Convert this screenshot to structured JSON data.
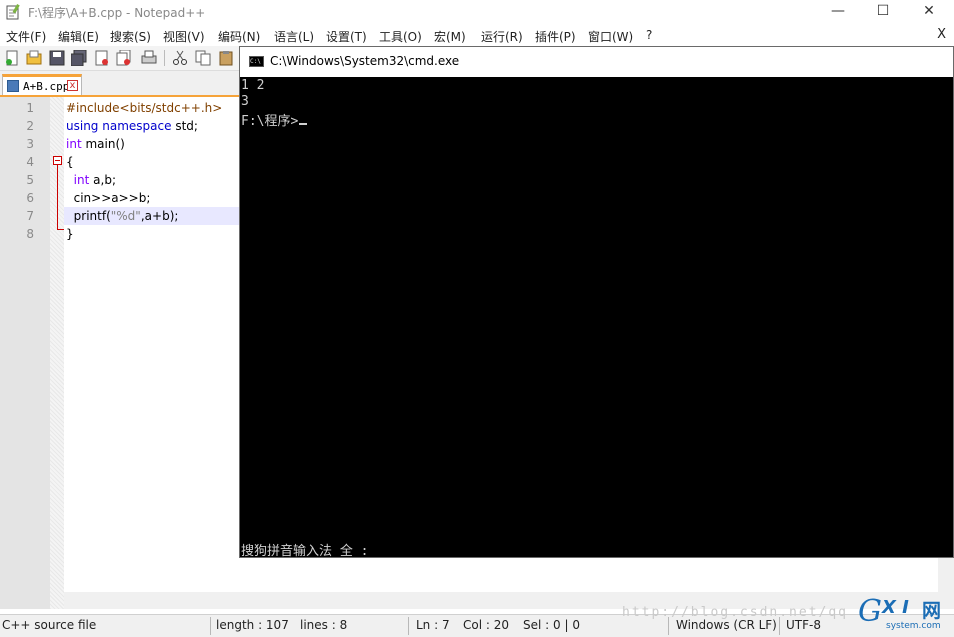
{
  "window": {
    "title": "F:\\程序\\A+B.cpp - Notepad++",
    "controls": {
      "minimize": "—",
      "maximize": "☐",
      "close": "✕"
    }
  },
  "menu": {
    "items": [
      "文件(F)",
      "编辑(E)",
      "搜索(S)",
      "视图(V)",
      "编码(N)",
      "语言(L)",
      "设置(T)",
      "工具(O)",
      "宏(M)",
      "运行(R)",
      "插件(P)",
      "窗口(W)",
      "?"
    ],
    "close_label": "X"
  },
  "toolbar": {
    "icons": [
      "new-file-icon",
      "open-file-icon",
      "save-icon",
      "save-all-icon",
      "close-icon",
      "close-all-icon",
      "print-icon",
      "cut-icon",
      "copy-icon",
      "paste-icon"
    ]
  },
  "tab": {
    "label": "A+B.cpp",
    "close": "x"
  },
  "editor": {
    "line_numbers": [
      "1",
      "2",
      "3",
      "4",
      "5",
      "6",
      "7",
      "8"
    ],
    "lines": [
      "#include<bits/stdc++.h>",
      "using namespace std;",
      "int main()",
      "{",
      "  int a,b;",
      "  cin>>a>>b;",
      "  printf(\"%d\",a+b);",
      "}"
    ],
    "current_line": 7
  },
  "statusbar": {
    "filetype": "C++ source file",
    "length": "length : 107",
    "lines": "lines : 8",
    "ln": "Ln : 7",
    "col": "Col : 20",
    "sel": "Sel : 0 | 0",
    "eol": "Windows (CR LF)",
    "encoding": "UTF-8"
  },
  "watermark": "http://blog.csdn.net/qq",
  "brand": {
    "g": "G",
    "xi": "X I",
    "wang": "网",
    "site": "system.com"
  },
  "cmd": {
    "title": "C:\\Windows\\System32\\cmd.exe",
    "icon_text": "C:\\",
    "output": [
      "1 2",
      "3",
      "F:\\程序>"
    ],
    "ime_status": "搜狗拼音输入法 全 :"
  },
  "colors": {
    "tab_accent": "#f6a339",
    "keyword": "#0000cc",
    "type": "#8000ff",
    "preprocessor": "#804000",
    "string": "#808080",
    "current_line": "#e8e8ff",
    "console_bg": "#000000",
    "console_fg": "#d0d0d0"
  }
}
